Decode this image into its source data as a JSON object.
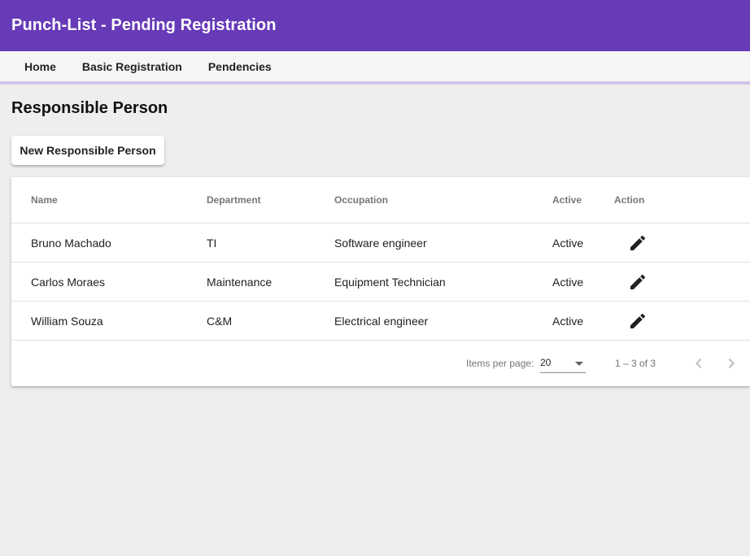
{
  "app": {
    "title": "Punch-List - Pending Registration"
  },
  "nav": {
    "items": [
      {
        "label": "Home"
      },
      {
        "label": "Basic Registration"
      },
      {
        "label": "Pendencies"
      }
    ]
  },
  "page": {
    "title": "Responsible Person",
    "new_button_label": "New Responsible Person"
  },
  "table": {
    "columns": {
      "name": "Name",
      "department": "Department",
      "occupation": "Occupation",
      "active": "Active",
      "action": "Action"
    },
    "rows": [
      {
        "name": "Bruno Machado",
        "department": "TI",
        "occupation": "Software engineer",
        "active": "Active",
        "action_icon": "edit-icon"
      },
      {
        "name": "Carlos Moraes",
        "department": "Maintenance",
        "occupation": "Equipment Technician",
        "active": "Active",
        "action_icon": "edit-icon"
      },
      {
        "name": "William Souza",
        "department": "C&M",
        "occupation": "Electrical engineer",
        "active": "Active",
        "action_icon": "edit-icon"
      }
    ]
  },
  "paginator": {
    "items_per_page_label": "Items per page:",
    "page_size": "20",
    "range_label": "1 – 3 of 3",
    "prev_icon": "chevron-left-icon",
    "next_icon": "chevron-right-icon"
  },
  "colors": {
    "toolbar": "#673ab7",
    "nav_background": "#f5f5f5",
    "nav_underline": "#d1c4e9",
    "page_background": "#eeeeee"
  }
}
